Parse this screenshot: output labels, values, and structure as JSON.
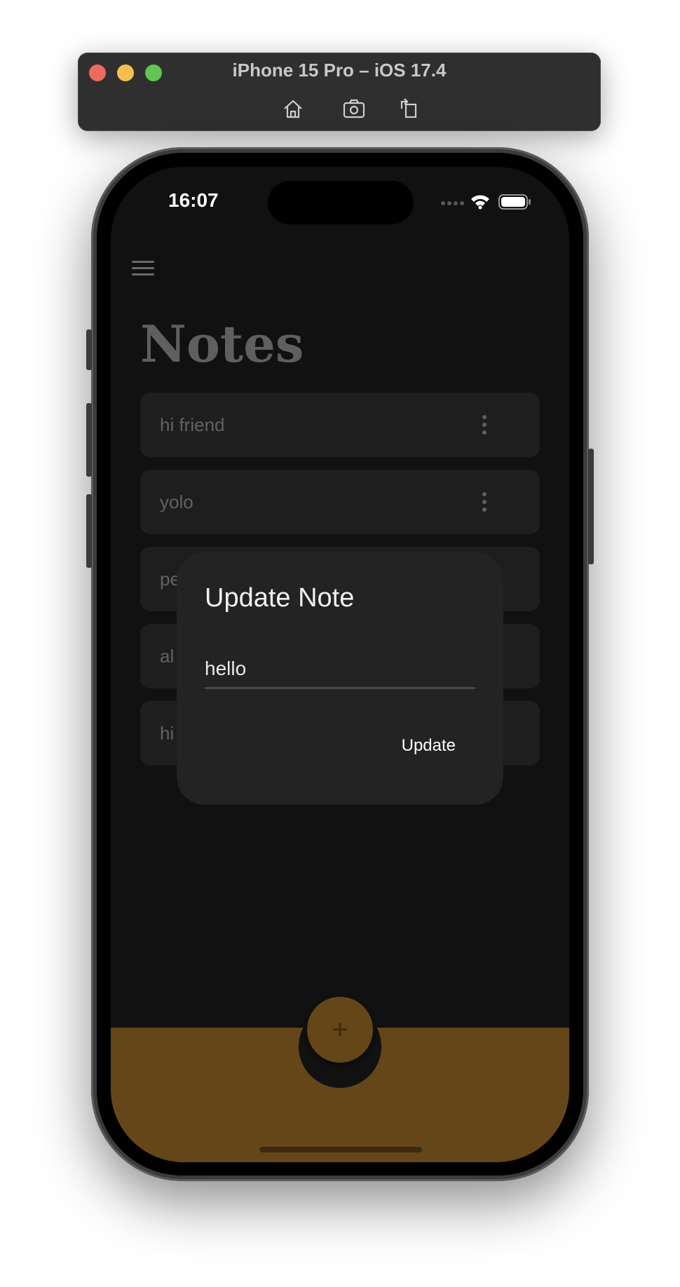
{
  "simulator": {
    "title": "iPhone 15 Pro – iOS 17.4",
    "tools": [
      "home-icon",
      "screenshot-icon",
      "rotate-icon"
    ]
  },
  "status_bar": {
    "time": "16:07"
  },
  "app": {
    "title": "Notes",
    "notes": [
      {
        "text": "hi friend"
      },
      {
        "text": "yolo"
      },
      {
        "text": "pe"
      },
      {
        "text": "al"
      },
      {
        "text": "hi"
      }
    ],
    "fab_label": "+"
  },
  "dialog": {
    "title": "Update Note",
    "input_value": "hello",
    "button_label": "Update"
  },
  "colors": {
    "background": "#111111",
    "accent": "#654618",
    "dialog": "#232323"
  }
}
